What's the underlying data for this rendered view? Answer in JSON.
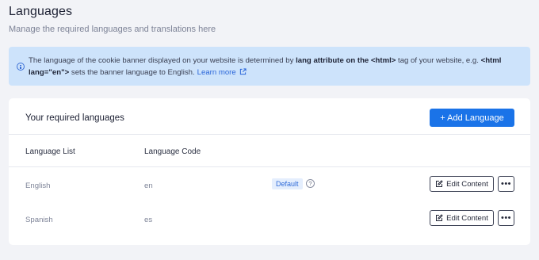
{
  "header": {
    "title": "Languages",
    "subtitle": "Manage the required languages and translations here"
  },
  "banner": {
    "icon": "info-icon",
    "text_1": "The language of the cookie banner displayed on your website is determined by ",
    "bold_1": "lang attribute on the <html>",
    "text_2": " tag of your website, e.g. ",
    "bold_2": "<html lang=\"en\">",
    "text_3": " sets the banner language to English.",
    "learn_more": "Learn more",
    "link_icon": "external-link-icon"
  },
  "card": {
    "title": "Your required languages",
    "add_button": "+ Add Language",
    "columns": [
      "Language List",
      "Language Code"
    ],
    "rows": [
      {
        "name": "English",
        "code": "en",
        "badge": "Default",
        "help": "?",
        "edit": "Edit Content",
        "more": "•••"
      },
      {
        "name": "Spanish",
        "code": "es",
        "badge": null,
        "help": null,
        "edit": "Edit Content",
        "more": "•••"
      }
    ]
  },
  "colors": {
    "accent": "#1a73e8",
    "banner_bg": "#cde3fb",
    "page_bg": "#f2f3f7"
  }
}
